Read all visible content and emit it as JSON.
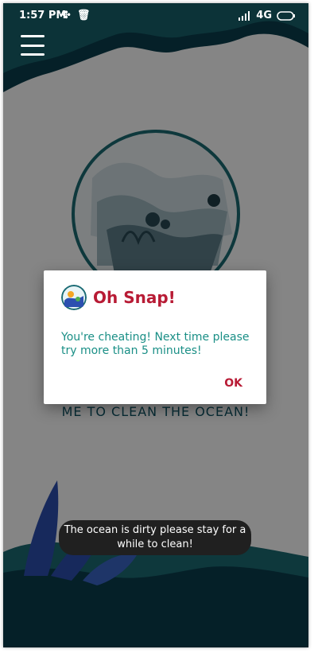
{
  "status_bar": {
    "time": "1:57 PM",
    "network": "4G",
    "left_icons": [
      "maple-leaf-icon",
      "trash-icon"
    ],
    "right_icons": [
      "signal-icon",
      "battery-icon"
    ]
  },
  "menu": {
    "icon": "hamburger-icon"
  },
  "background_text": "ME TO CLEAN THE OCEAN!",
  "dialog": {
    "title": "Oh Snap!",
    "message": "You're cheating! Next time please try more than 5 minutes!",
    "ok_label": "OK",
    "logo": "ocean-logo-icon"
  },
  "toast": {
    "text": "The ocean is dirty please stay for a while to clean!"
  },
  "colors": {
    "ocean_dark": "#0b3f4d",
    "ocean_teal": "#1b6b74",
    "accent_red": "#b81b35",
    "accent_teal": "#1a8f86",
    "toast_bg": "#202020"
  }
}
